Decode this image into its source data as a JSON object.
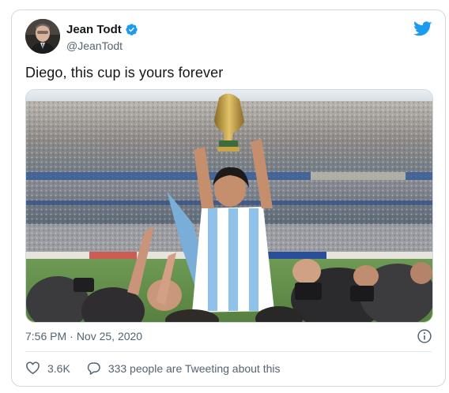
{
  "tweet": {
    "author": {
      "display_name": "Jean Todt",
      "handle": "@JeanTodt",
      "verified": true,
      "avatar_icon": "avatar-photo"
    },
    "text": "Diego, this cup is yours forever",
    "media": {
      "type": "photo",
      "icon": "stadium-photo"
    },
    "time": "7:56 PM",
    "separator": "·",
    "date": "Nov 25, 2020",
    "info_icon": "info-icon",
    "actions": {
      "likes": {
        "icon": "heart-icon",
        "count": "3.6K"
      },
      "conversation": {
        "icon": "speech-bubble-icon",
        "label": "333 people are Tweeting about this"
      }
    }
  },
  "brand": {
    "logo_icon": "twitter-bird-icon",
    "color": "#1d9bf0",
    "text_secondary": "#536471"
  }
}
